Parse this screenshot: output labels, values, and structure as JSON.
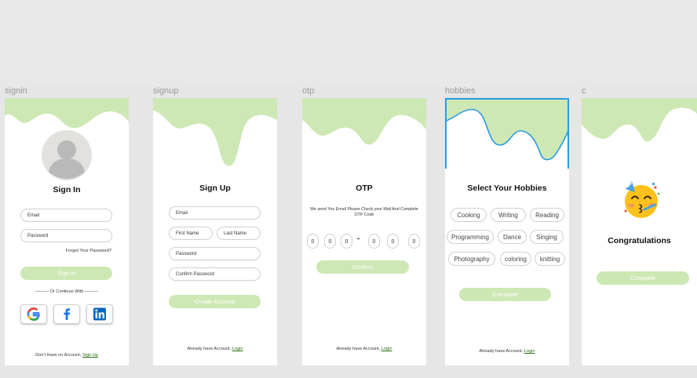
{
  "frames": {
    "signin": "signin",
    "signup": "signup",
    "otp": "otp",
    "hobbies": "hobbies",
    "congrats": "c"
  },
  "colors": {
    "wave_green": "#cde8b4",
    "button_green": "#cde8b4",
    "selection_blue": "#2b9be0",
    "link_green": "#2a6e12"
  },
  "signin": {
    "title": "Sign In",
    "email_placeholder": "Email",
    "password_placeholder": "Password",
    "forgot": "Forget Your Password?",
    "button": "Sign In",
    "or_continue": "——— Or Continue With ———",
    "social_icons": [
      "google-icon",
      "facebook-icon",
      "linkedin-icon"
    ],
    "footer_text": "Don't Have on Account,",
    "footer_link": "Sign Up"
  },
  "signup": {
    "title": "Sign Up",
    "email_placeholder": "Email",
    "first_name_placeholder": "First Name",
    "last_name_placeholder": "Last Name",
    "password_placeholder": "Password",
    "confirm_password_placeholder": "Confirm Password",
    "button": "Create Account",
    "footer_text": "Already have Account,",
    "footer_link": "Login"
  },
  "otp": {
    "title": "OTP",
    "message": "We send You Email Please Check your Mail And Complete OTP Code",
    "digits": [
      "0",
      "0",
      "0",
      "0",
      "0",
      "0"
    ],
    "separator": "-",
    "button": "Confirm",
    "footer_text": "Already have Account,",
    "footer_link": "Login"
  },
  "hobbies": {
    "title": "Select Your Hobbies",
    "chips": [
      "Cooking",
      "Writing",
      "Reading",
      "Programming",
      "Dance",
      "Singing",
      "Photography",
      "coloring",
      "knitting"
    ],
    "button": "Complete",
    "footer_text": "Already have Account,",
    "footer_link": "Login"
  },
  "congrats": {
    "emoji": "🥳",
    "title": "Congratulations",
    "button": "Complete"
  }
}
